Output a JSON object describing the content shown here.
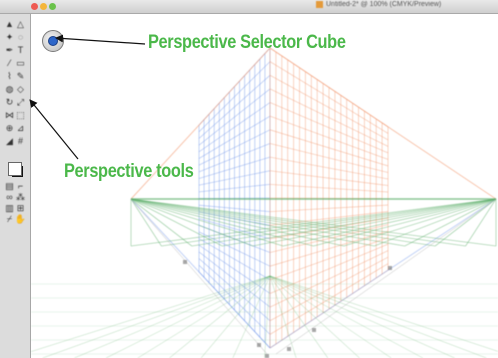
{
  "window": {
    "title": "Untitled-2* @ 100% (CMYK/Preview)",
    "controls": [
      "close-button",
      "minimize-button",
      "zoom-button"
    ]
  },
  "toolbox": {
    "tools": [
      {
        "id": "selection",
        "icon": "selection-arrow-icon",
        "glyph": "▲"
      },
      {
        "id": "direct-selection",
        "icon": "direct-selection-icon",
        "glyph": "△"
      },
      {
        "id": "magic-wand",
        "icon": "magic-wand-icon",
        "glyph": "✦"
      },
      {
        "id": "lasso",
        "icon": "lasso-icon",
        "glyph": "◌"
      },
      {
        "id": "pen",
        "icon": "pen-icon",
        "glyph": "✒"
      },
      {
        "id": "type",
        "icon": "type-icon",
        "glyph": "T"
      },
      {
        "id": "line",
        "icon": "line-icon",
        "glyph": "⁄"
      },
      {
        "id": "rectangle",
        "icon": "rectangle-icon",
        "glyph": "▭"
      },
      {
        "id": "paintbrush",
        "icon": "paintbrush-icon",
        "glyph": "⌇"
      },
      {
        "id": "pencil",
        "icon": "pencil-icon",
        "glyph": "✎"
      },
      {
        "id": "blob-brush",
        "icon": "blob-brush-icon",
        "glyph": "◍"
      },
      {
        "id": "eraser",
        "icon": "eraser-icon",
        "glyph": "◇"
      },
      {
        "id": "rotate",
        "icon": "rotate-icon",
        "glyph": "↻"
      },
      {
        "id": "scale",
        "icon": "scale-icon",
        "glyph": "⤢"
      },
      {
        "id": "width",
        "icon": "width-icon",
        "glyph": "⋈"
      },
      {
        "id": "free-transform",
        "icon": "free-transform-icon",
        "glyph": "⬚"
      },
      {
        "id": "shape-builder",
        "icon": "shape-builder-icon",
        "glyph": "⊕"
      },
      {
        "id": "perspective-grid",
        "icon": "perspective-grid-icon",
        "glyph": "⊿"
      },
      {
        "id": "perspective-selection",
        "icon": "perspective-selection-icon",
        "glyph": "◢"
      },
      {
        "id": "mesh",
        "icon": "mesh-icon",
        "glyph": "#"
      },
      {
        "id": "gradient",
        "icon": "gradient-icon",
        "glyph": "▤"
      },
      {
        "id": "eyedropper",
        "icon": "eyedropper-icon",
        "glyph": "⌐"
      },
      {
        "id": "blend",
        "icon": "blend-icon",
        "glyph": "∞"
      },
      {
        "id": "symbol-sprayer",
        "icon": "symbol-sprayer-icon",
        "glyph": "⁂"
      },
      {
        "id": "graph",
        "icon": "graph-icon",
        "glyph": "▥"
      },
      {
        "id": "artboard",
        "icon": "artboard-icon",
        "glyph": "⊞"
      },
      {
        "id": "slice",
        "icon": "slice-icon",
        "glyph": "⌿"
      },
      {
        "id": "hand",
        "icon": "hand-icon",
        "glyph": "✋"
      },
      {
        "id": "zoom",
        "icon": "zoom-icon",
        "glyph": "⚲"
      }
    ],
    "colors": {
      "fill": "#ffffff",
      "stroke": "#111111"
    }
  },
  "canvas": {
    "perspective_selector": {
      "icon": "perspective-selector-cube-icon",
      "active_plane": "left",
      "color": "#2d66c9"
    },
    "grid_colors": {
      "left_plane": "#5b86e6",
      "right_plane": "#f08a5c",
      "ground_plane": "#3a9e4a"
    }
  },
  "callouts": {
    "cube": "Perspective Selector Cube",
    "tools": "Perspective tools",
    "color": "#4bb84a"
  }
}
